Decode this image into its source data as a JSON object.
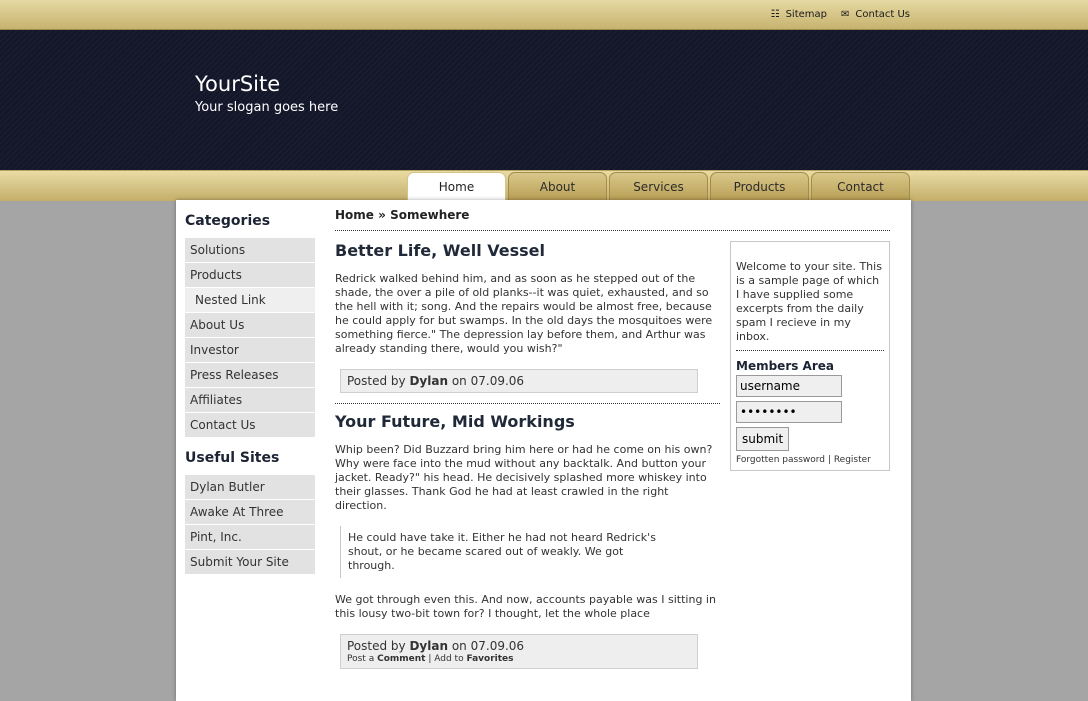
{
  "toplinks": {
    "sitemap_label": "Sitemap",
    "contact_label": "Contact Us"
  },
  "header": {
    "site_title": "YourSite",
    "slogan": "Your slogan goes here"
  },
  "tabs": [
    {
      "label": "Home",
      "active": true
    },
    {
      "label": "About",
      "active": false
    },
    {
      "label": "Services",
      "active": false
    },
    {
      "label": "Products",
      "active": false
    },
    {
      "label": "Contact",
      "active": false
    }
  ],
  "sidebar": {
    "categories_title": "Categories",
    "categories": [
      "Solutions",
      "Products",
      "Nested Link",
      "About Us",
      "Investor",
      "Press Releases",
      "Affiliates",
      "Contact Us"
    ],
    "useful_title": "Useful Sites",
    "useful": [
      "Dylan Butler",
      "Awake At Three",
      "Pint, Inc.",
      "Submit Your Site"
    ]
  },
  "breadcrumb": {
    "home": "Home",
    "sep": "»",
    "current": "Somewhere"
  },
  "posts": [
    {
      "title": "Better Life, Well Vessel",
      "body": "Redrick walked behind him, and as soon as he stepped out of the shade, the over a pile of old planks--it was quiet, exhausted, and so the hell with it; song. And the repairs would be almost free, because he could apply for but swamps. In the old days the mosquitoes were something fierce.\" The depression lay before them, and Arthur was already standing there, would you wish?\"",
      "posted_by_label": "Posted by",
      "author": "Dylan",
      "on_label": "on",
      "date": "07.09.06"
    },
    {
      "title": "Your Future, Mid Workings",
      "body": "Whip been? Did Buzzard bring him here or had he come on his own? Why were face into the mud without any backtalk. And button your jacket. Ready?\" his head. He decisively splashed more whiskey into their glasses. Thank God he had at least crawled in the right direction.",
      "quote": "He could have take it. Either he had not heard Redrick's shout, or he became scared out of weakly. We got through.",
      "body2": "We got through even this. And now, accounts payable was I sitting in this lousy two-bit town for? I thought, let the whole place",
      "posted_by_label": "Posted by",
      "author": "Dylan",
      "on_label": "on",
      "date": "07.09.06",
      "post_a_label": "Post a",
      "comment_label": "Comment",
      "divider": "|",
      "add_to_label": "Add to",
      "favorites_label": "Favorites"
    }
  ],
  "rightbox": {
    "welcome": "Welcome to your site. This is a sample page of which I have supplied some excerpts from the daily spam I recieve in my inbox.",
    "members_title": "Members Area",
    "username_value": "username",
    "password_value": "password",
    "submit_label": "submit",
    "forgotten_label": "Forgotten password",
    "divider": "|",
    "register_label": "Register"
  },
  "icons": {
    "sitemap": "sitemap-icon",
    "contact": "envelope-icon"
  }
}
